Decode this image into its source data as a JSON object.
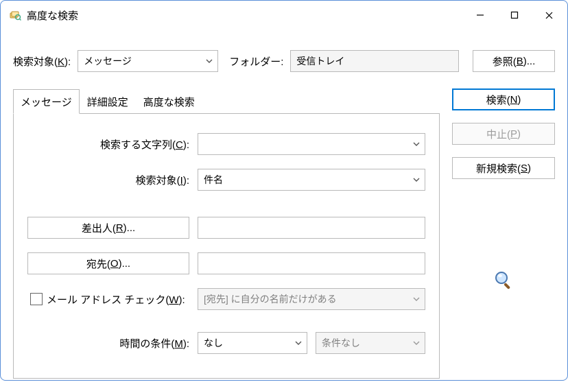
{
  "window": {
    "title": "高度な検索"
  },
  "top": {
    "target_label_pre": "検索対象(",
    "target_label_u": "K",
    "target_label_post": "):",
    "target_value": "メッセージ",
    "folder_label": "フォルダー:",
    "folder_value": "受信トレイ",
    "browse_pre": "参照(",
    "browse_u": "B",
    "browse_post": ")..."
  },
  "tabs": {
    "message": "メッセージ",
    "advanced_settings": "詳細設定",
    "advanced_find": "高度な検索"
  },
  "buttons": {
    "find_pre": "検索(",
    "find_u": "N",
    "find_post": ")",
    "stop_pre": "中止(",
    "stop_u": "P",
    "stop_post": ")",
    "new_pre": "新規検索(",
    "new_u": "S",
    "new_post": ")"
  },
  "panel": {
    "search_text_label_pre": "検索する文字列(",
    "search_text_label_u": "C",
    "search_text_label_post": "):",
    "search_text_value": "",
    "search_in_label_pre": "検索対象(",
    "search_in_label_u": "I",
    "search_in_label_post": "):",
    "search_in_value": "件名",
    "from_pre": "差出人(",
    "from_u": "R",
    "from_post": ")...",
    "from_value": "",
    "to_pre": "宛先(",
    "to_u": "O",
    "to_post": ")...",
    "to_value": "",
    "only_label_pre": "メール アドレス チェック(",
    "only_label_u": "W",
    "only_label_post": "):",
    "only_value": "[宛先] に自分の名前だけがある",
    "time_label_pre": "時間の条件(",
    "time_label_u": "M",
    "time_label_post": "):",
    "time_value": "なし",
    "time_cond_value": "条件なし"
  }
}
